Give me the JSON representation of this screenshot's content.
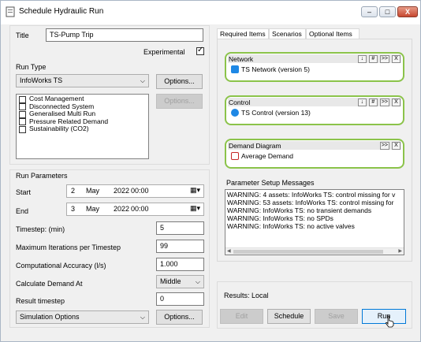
{
  "window": {
    "title": "Schedule Hydraulic Run",
    "buttons": {
      "minimize": "–",
      "maximize": "□",
      "close": "X"
    }
  },
  "form": {
    "title_label": "Title",
    "title_value": "TS-Pump Trip",
    "experimental_label": "Experimental",
    "experimental_checked": true
  },
  "run_type": {
    "section_label": "Run Type",
    "selected": "InfoWorks TS",
    "options_button": "Options...",
    "options_button_disabled": "Options...",
    "items": [
      "Cost Management",
      "Disconnected System",
      "Generalised Multi Run",
      "Pressure Related Demand",
      "Sustainability (CO2)"
    ]
  },
  "run_parameters": {
    "section_label": "Run Parameters",
    "start_label": "Start",
    "start": {
      "day": "2",
      "month": "May",
      "year": "2022",
      "time": "00:00"
    },
    "end_label": "End",
    "end": {
      "day": "3",
      "month": "May",
      "year": "2022",
      "time": "00:00"
    },
    "timestep_label": "Timestep: (min)",
    "timestep_value": "5",
    "max_iterations_label": "Maximum Iterations per Timestep",
    "max_iterations_value": "99",
    "accuracy_label": "Computational Accuracy (l/s)",
    "accuracy_value": "1.000",
    "calc_demand_label": "Calculate Demand At",
    "calc_demand_value": "Middle",
    "result_timestep_label": "Result timestep",
    "result_timestep_value": "0",
    "simulation_options_value": "Simulation Options",
    "simulation_options_button": "Options..."
  },
  "tabs": [
    "Required Items",
    "Scenarios",
    "Optional Items"
  ],
  "network": {
    "title": "Network",
    "mini_buttons": [
      "↓",
      "#",
      ">>",
      "X"
    ],
    "item": "TS Network (version 5)"
  },
  "control": {
    "title": "Control",
    "mini_buttons": [
      "↓",
      "#",
      ">>",
      "X"
    ],
    "item": "TS Control (version 13)"
  },
  "demand": {
    "title": "Demand Diagram",
    "mini_buttons": [
      ">>",
      "X"
    ],
    "item": "Average Demand"
  },
  "messages": {
    "label": "Parameter Setup Messages",
    "lines": [
      "WARNING: 4 assets: InfoWorks TS: control missing for v",
      "WARNING: 53 assets: InfoWorks TS: control missing for",
      "WARNING: InfoWorks TS: no transient demands",
      "WARNING: InfoWorks TS: no SPDs",
      "WARNING: InfoWorks TS: no active valves"
    ]
  },
  "results": {
    "label": "Results: Local",
    "edit": "Edit",
    "schedule": "Schedule",
    "save": "Save",
    "run": "Run"
  },
  "colors": {
    "accent_green": "#8bc34a",
    "focus_blue": "#0078d7"
  }
}
